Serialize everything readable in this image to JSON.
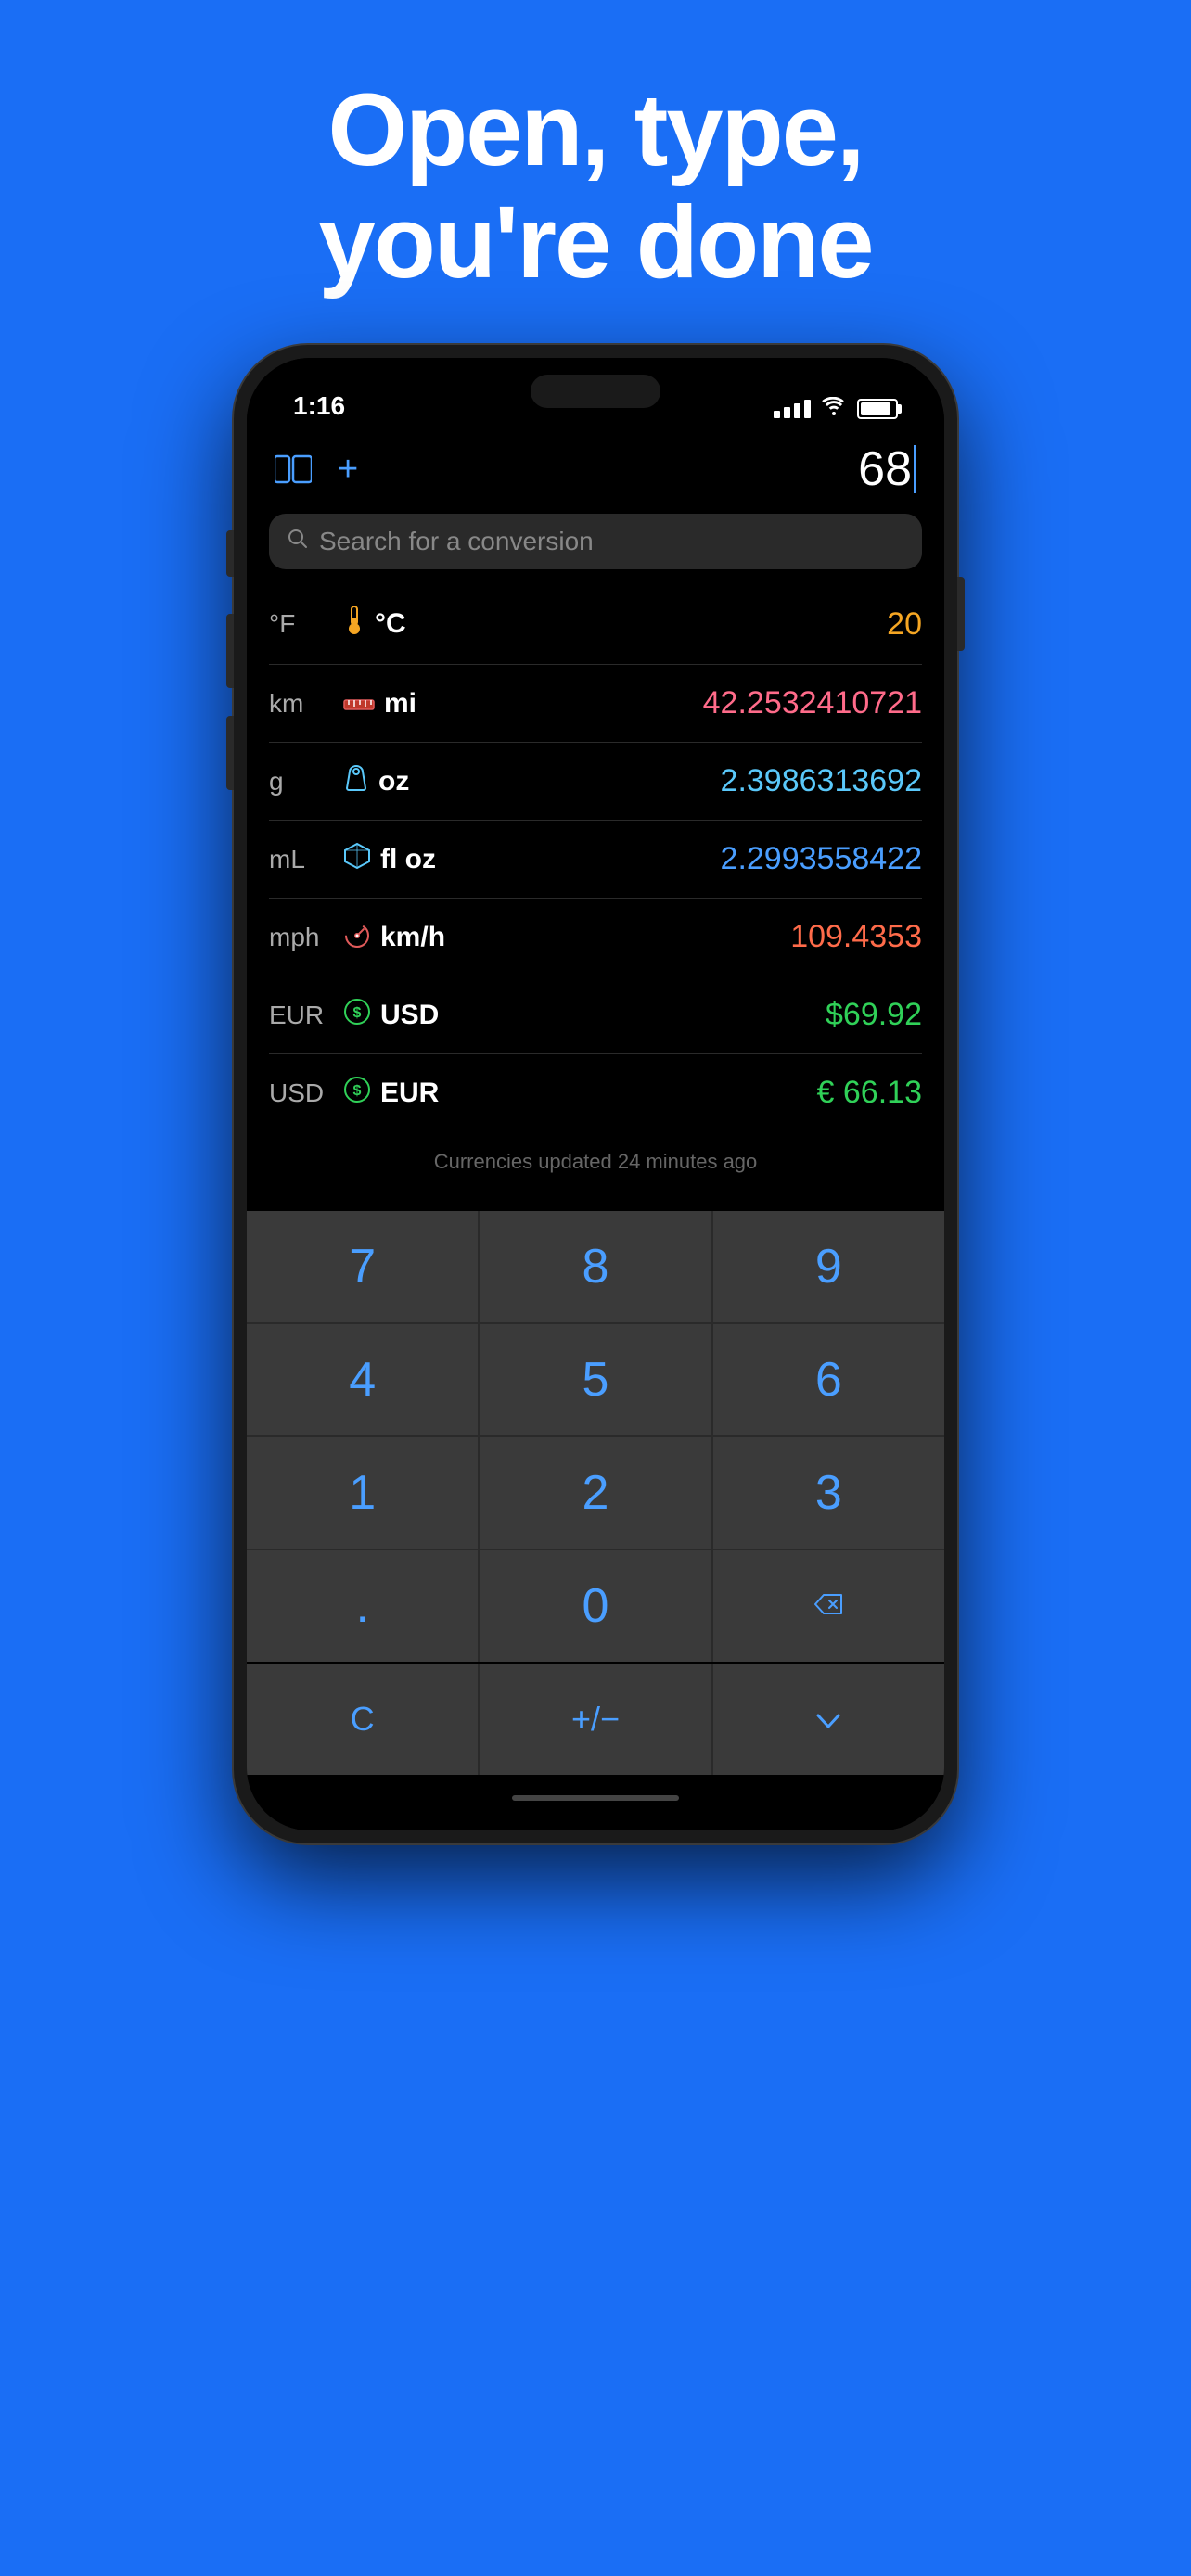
{
  "hero": {
    "title_line1": "Open, type,",
    "title_line2": "you're done"
  },
  "status_bar": {
    "time": "1:16"
  },
  "toolbar": {
    "current_value": "68",
    "add_label": "+"
  },
  "search": {
    "placeholder": "Search for a conversion"
  },
  "conversions": [
    {
      "from": "°F",
      "icon": "🌡",
      "icon_type": "thermometer",
      "to": "°C",
      "result": "20",
      "result_color": "result-orange"
    },
    {
      "from": "km",
      "icon": "📏",
      "icon_type": "ruler",
      "to": "mi",
      "result": "42.2532410721",
      "result_color": "result-pink"
    },
    {
      "from": "g",
      "icon": "⚖",
      "icon_type": "weight",
      "to": "oz",
      "result": "2.3986313692",
      "result_color": "result-cyan"
    },
    {
      "from": "mL",
      "icon": "🧊",
      "icon_type": "cube",
      "to": "fl oz",
      "result": "2.2993558422",
      "result_color": "result-blue"
    },
    {
      "from": "mph",
      "icon": "🎯",
      "icon_type": "speed",
      "to": "km/h",
      "result": "109.4353",
      "result_color": "result-red"
    },
    {
      "from": "EUR",
      "icon": "💲",
      "icon_type": "currency-eur",
      "to": "USD",
      "result": "$69.92",
      "result_color": "result-green"
    },
    {
      "from": "USD",
      "icon": "💲",
      "icon_type": "currency-usd",
      "to": "EUR",
      "result": "€ 66.13",
      "result_color": "result-green"
    }
  ],
  "currency_note": "Currencies updated 24 minutes ago",
  "keypad": {
    "rows": [
      [
        "7",
        "8",
        "9"
      ],
      [
        "4",
        "5",
        "6"
      ],
      [
        "1",
        "2",
        "3"
      ],
      [
        ".",
        "0",
        "⌫"
      ]
    ],
    "bottom_row": [
      "C",
      "+/−",
      "∨"
    ]
  }
}
